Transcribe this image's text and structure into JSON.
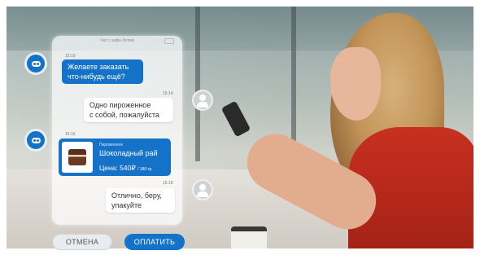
{
  "chat": {
    "header": "Чат с кафе-ботом",
    "messages": [
      {
        "sender": "bot",
        "time": "15:10",
        "text_line1": "Желаете заказать",
        "text_line2": "что-нибудь ещё?"
      },
      {
        "sender": "user",
        "time": "15:14",
        "text_line1": "Одно пироженное",
        "text_line2": "с собой, пожалуйста"
      },
      {
        "sender": "bot",
        "time": "15:16"
      },
      {
        "sender": "user",
        "time": "15:18",
        "text_line1": "Отлично, беру,",
        "text_line2": "упакуйте"
      }
    ],
    "product_card": {
      "category": "Пироженное",
      "name": "Шоколадный рай",
      "price": "Цена: 540₽",
      "weight": "/ 180 гр."
    }
  },
  "buttons": {
    "cancel": "ОТМЕНА",
    "pay": "ОПЛАТИТЬ"
  },
  "icons": {
    "bot": "bot-avatar-icon",
    "user": "user-avatar-icon",
    "product": "cake-icon"
  },
  "colors": {
    "accent": "#1572c9",
    "accessory": "#c8301f"
  }
}
